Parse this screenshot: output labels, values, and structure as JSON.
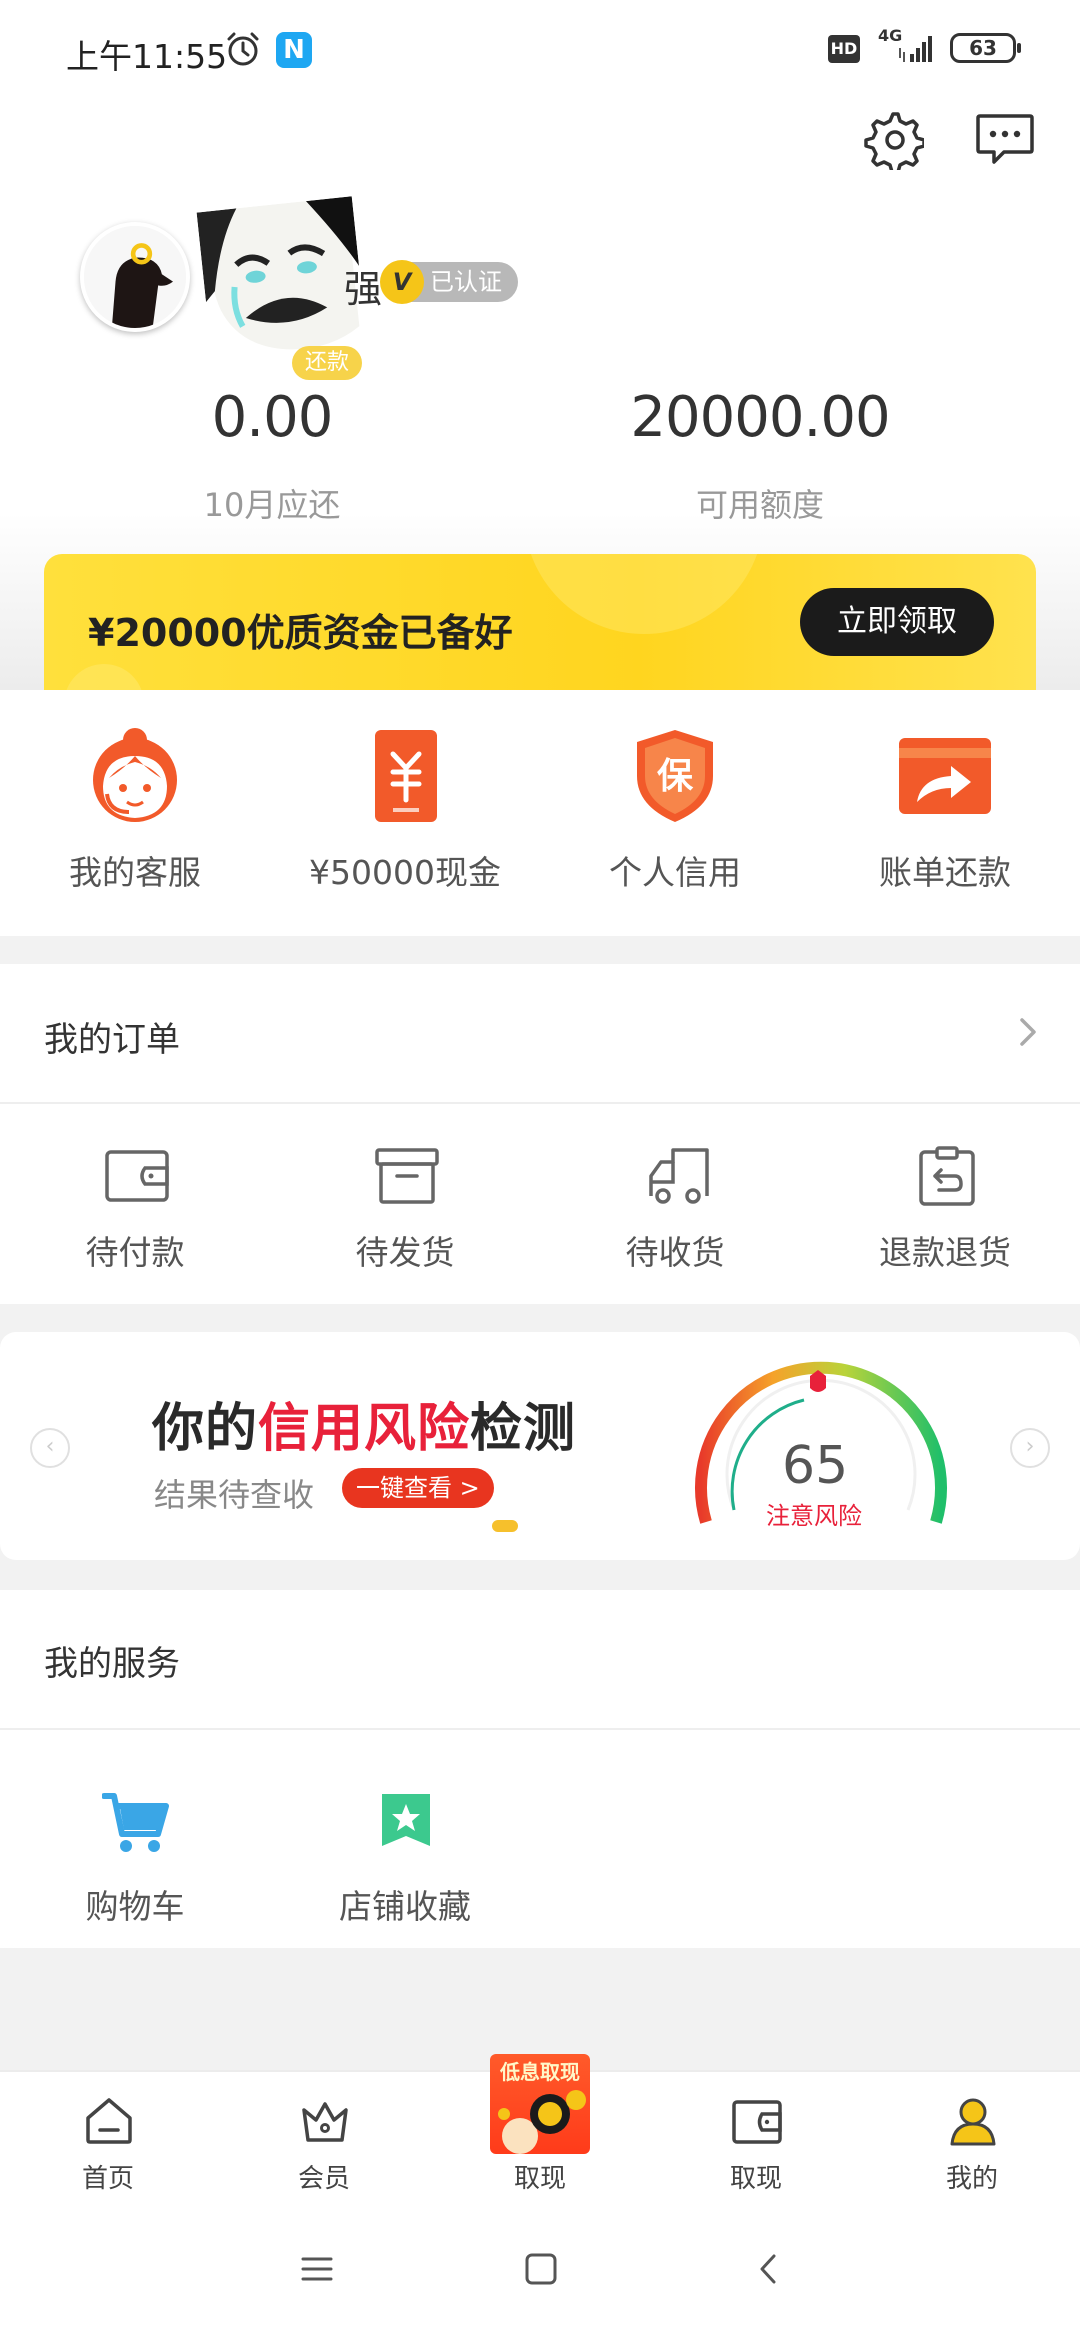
{
  "status_bar": {
    "time": "上午11:55",
    "hd": "HD",
    "network": "4G",
    "battery": "63",
    "app_badge": "N"
  },
  "header": {
    "name_tail": "强",
    "verified_badge": "已认证",
    "verified_mark": "V",
    "repay_tag": "还款",
    "stats": [
      {
        "value": "0.00",
        "label": "10月应还"
      },
      {
        "value": "20000.00",
        "label": "可用额度"
      }
    ]
  },
  "promo": {
    "text": "¥20000优质资金已备好",
    "button": "立即领取",
    "color": "#ffd51f"
  },
  "quick_menu": [
    {
      "label": "我的客服",
      "icon": "customer-service-icon"
    },
    {
      "label": "¥50000现金",
      "icon": "cash-icon"
    },
    {
      "label": "个人信用",
      "icon": "credit-shield-icon"
    },
    {
      "label": "账单还款",
      "icon": "bill-repay-icon"
    }
  ],
  "orders": {
    "title": "我的订单",
    "items": [
      {
        "label": "待付款",
        "icon": "wallet-icon"
      },
      {
        "label": "待发货",
        "icon": "box-icon"
      },
      {
        "label": "待收货",
        "icon": "truck-icon"
      },
      {
        "label": "退款退货",
        "icon": "return-icon"
      }
    ]
  },
  "banner": {
    "title_prefix": "你的",
    "title_highlight": "信用风险",
    "title_suffix": "检测",
    "subtitle": "结果待查收",
    "cta": "一键查看 >",
    "score": "65",
    "risk_label": "注意风险",
    "arrow_left": "‹",
    "arrow_right": "›"
  },
  "services": {
    "title": "我的服务",
    "items": [
      {
        "label": "购物车",
        "icon": "cart-icon"
      },
      {
        "label": "店铺收藏",
        "icon": "store-favorite-icon"
      }
    ]
  },
  "tabbar": {
    "promo_text": "低息取现",
    "items": [
      {
        "label": "首页",
        "icon": "home-icon"
      },
      {
        "label": "会员",
        "icon": "crown-icon"
      },
      {
        "label": "取现",
        "icon": "promo-cash-icon"
      },
      {
        "label": "取现",
        "icon": "wallet-icon"
      },
      {
        "label": "我的",
        "icon": "profile-icon"
      }
    ]
  }
}
